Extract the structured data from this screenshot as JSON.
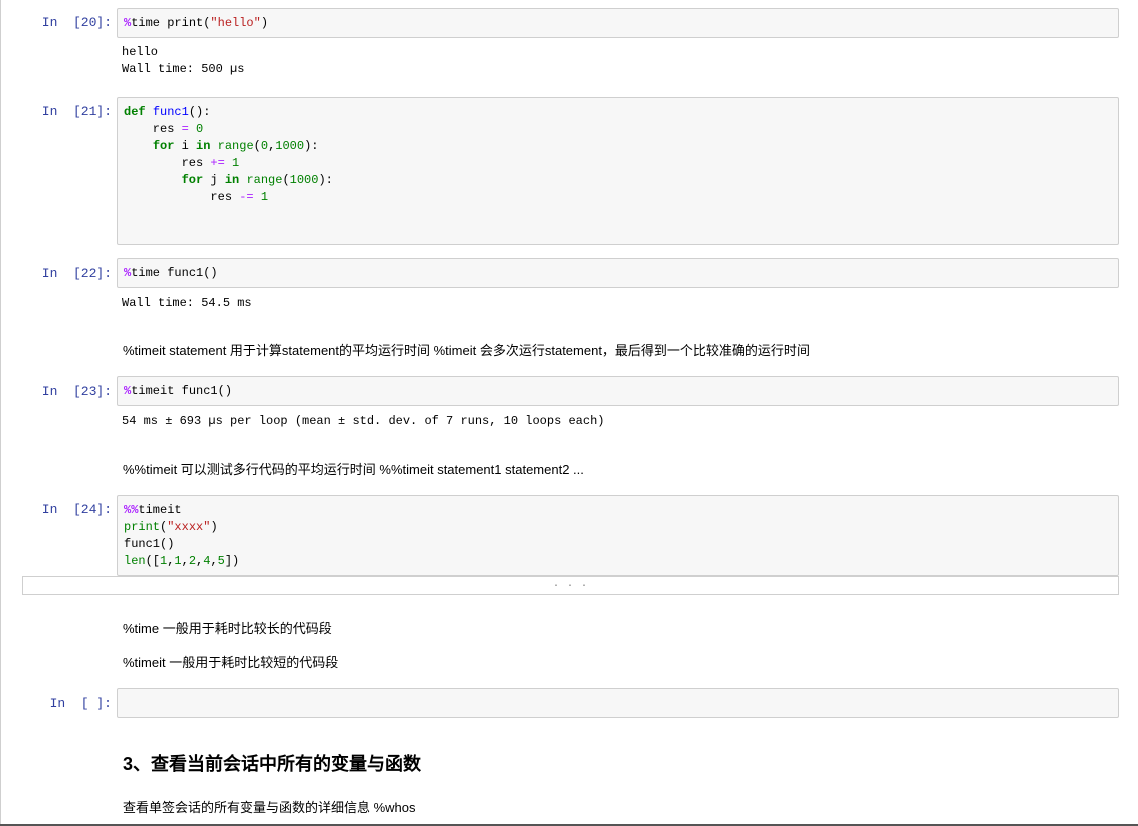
{
  "cells": {
    "c20": {
      "prompt": "In  [20]:",
      "code": [
        [
          {
            "t": "%",
            "c": "mg"
          },
          {
            "t": "time print(",
            "c": ""
          },
          {
            "t": "\"hello\"",
            "c": "s"
          },
          {
            "t": ")",
            "c": ""
          }
        ]
      ],
      "output": "hello\nWall time: 500 µs"
    },
    "c21": {
      "prompt": "In  [21]:",
      "code": [
        [
          {
            "t": "def",
            "c": "k"
          },
          {
            "t": " ",
            "c": ""
          },
          {
            "t": "func1",
            "c": "nf"
          },
          {
            "t": "():",
            "c": ""
          }
        ],
        [
          {
            "t": "    res ",
            "c": ""
          },
          {
            "t": "=",
            "c": "o"
          },
          {
            "t": " ",
            "c": ""
          },
          {
            "t": "0",
            "c": "mi"
          }
        ],
        [
          {
            "t": "    ",
            "c": ""
          },
          {
            "t": "for",
            "c": "k"
          },
          {
            "t": " i ",
            "c": ""
          },
          {
            "t": "in",
            "c": "k"
          },
          {
            "t": " ",
            "c": ""
          },
          {
            "t": "range",
            "c": "nb"
          },
          {
            "t": "(",
            "c": ""
          },
          {
            "t": "0",
            "c": "mi"
          },
          {
            "t": ",",
            "c": ""
          },
          {
            "t": "1000",
            "c": "mi"
          },
          {
            "t": "):",
            "c": ""
          }
        ],
        [
          {
            "t": "        res ",
            "c": ""
          },
          {
            "t": "+=",
            "c": "o"
          },
          {
            "t": " ",
            "c": ""
          },
          {
            "t": "1",
            "c": "mi"
          }
        ],
        [
          {
            "t": "        ",
            "c": ""
          },
          {
            "t": "for",
            "c": "k"
          },
          {
            "t": " j ",
            "c": ""
          },
          {
            "t": "in",
            "c": "k"
          },
          {
            "t": " ",
            "c": ""
          },
          {
            "t": "range",
            "c": "nb"
          },
          {
            "t": "(",
            "c": ""
          },
          {
            "t": "1000",
            "c": "mi"
          },
          {
            "t": "):",
            "c": ""
          }
        ],
        [
          {
            "t": "            res ",
            "c": ""
          },
          {
            "t": "-=",
            "c": "o"
          },
          {
            "t": " ",
            "c": ""
          },
          {
            "t": "1",
            "c": "mi"
          }
        ]
      ]
    },
    "c22": {
      "prompt": "In  [22]:",
      "code": [
        [
          {
            "t": "%",
            "c": "mg"
          },
          {
            "t": "time func1()",
            "c": ""
          }
        ]
      ],
      "output": "Wall time: 54.5 ms"
    },
    "md1": "%timeit statement 用于计算statement的平均运行时间 %timeit 会多次运行statement，最后得到一个比较准确的运行时间",
    "c23": {
      "prompt": "In  [23]:",
      "code": [
        [
          {
            "t": "%",
            "c": "mg"
          },
          {
            "t": "timeit func1()",
            "c": ""
          }
        ]
      ],
      "output": "54 ms ± 693 µs per loop (mean ± std. dev. of 7 runs, 10 loops each)"
    },
    "md2": "%%timeit 可以测试多行代码的平均运行时间 %%timeit statement1 statement2 ...",
    "c24": {
      "prompt": "In  [24]:",
      "code": [
        [
          {
            "t": "%%",
            "c": "mg"
          },
          {
            "t": "timeit",
            "c": ""
          }
        ],
        [
          {
            "t": "print",
            "c": "nb"
          },
          {
            "t": "(",
            "c": ""
          },
          {
            "t": "\"xxxx\"",
            "c": "s"
          },
          {
            "t": ")",
            "c": ""
          }
        ],
        [
          {
            "t": "func1()",
            "c": ""
          }
        ],
        [
          {
            "t": "len",
            "c": "nb"
          },
          {
            "t": "([",
            "c": ""
          },
          {
            "t": "1",
            "c": "mi"
          },
          {
            "t": ",",
            "c": ""
          },
          {
            "t": "1",
            "c": "mi"
          },
          {
            "t": ",",
            "c": ""
          },
          {
            "t": "2",
            "c": "mi"
          },
          {
            "t": ",",
            "c": ""
          },
          {
            "t": "4",
            "c": "mi"
          },
          {
            "t": ",",
            "c": ""
          },
          {
            "t": "5",
            "c": "mi"
          },
          {
            "t": "])",
            "c": ""
          }
        ]
      ],
      "collapsed_output": ". . ."
    },
    "md3": "%time 一般用于耗时比较长的代码段",
    "md4": "%timeit 一般用于耗时比较短的代码段",
    "c25": {
      "prompt": "In  [ ]:"
    },
    "md5_heading": "3、查看当前会话中所有的变量与函数",
    "md6": "查看单签会话的所有变量与函数的详细信息 %whos"
  }
}
